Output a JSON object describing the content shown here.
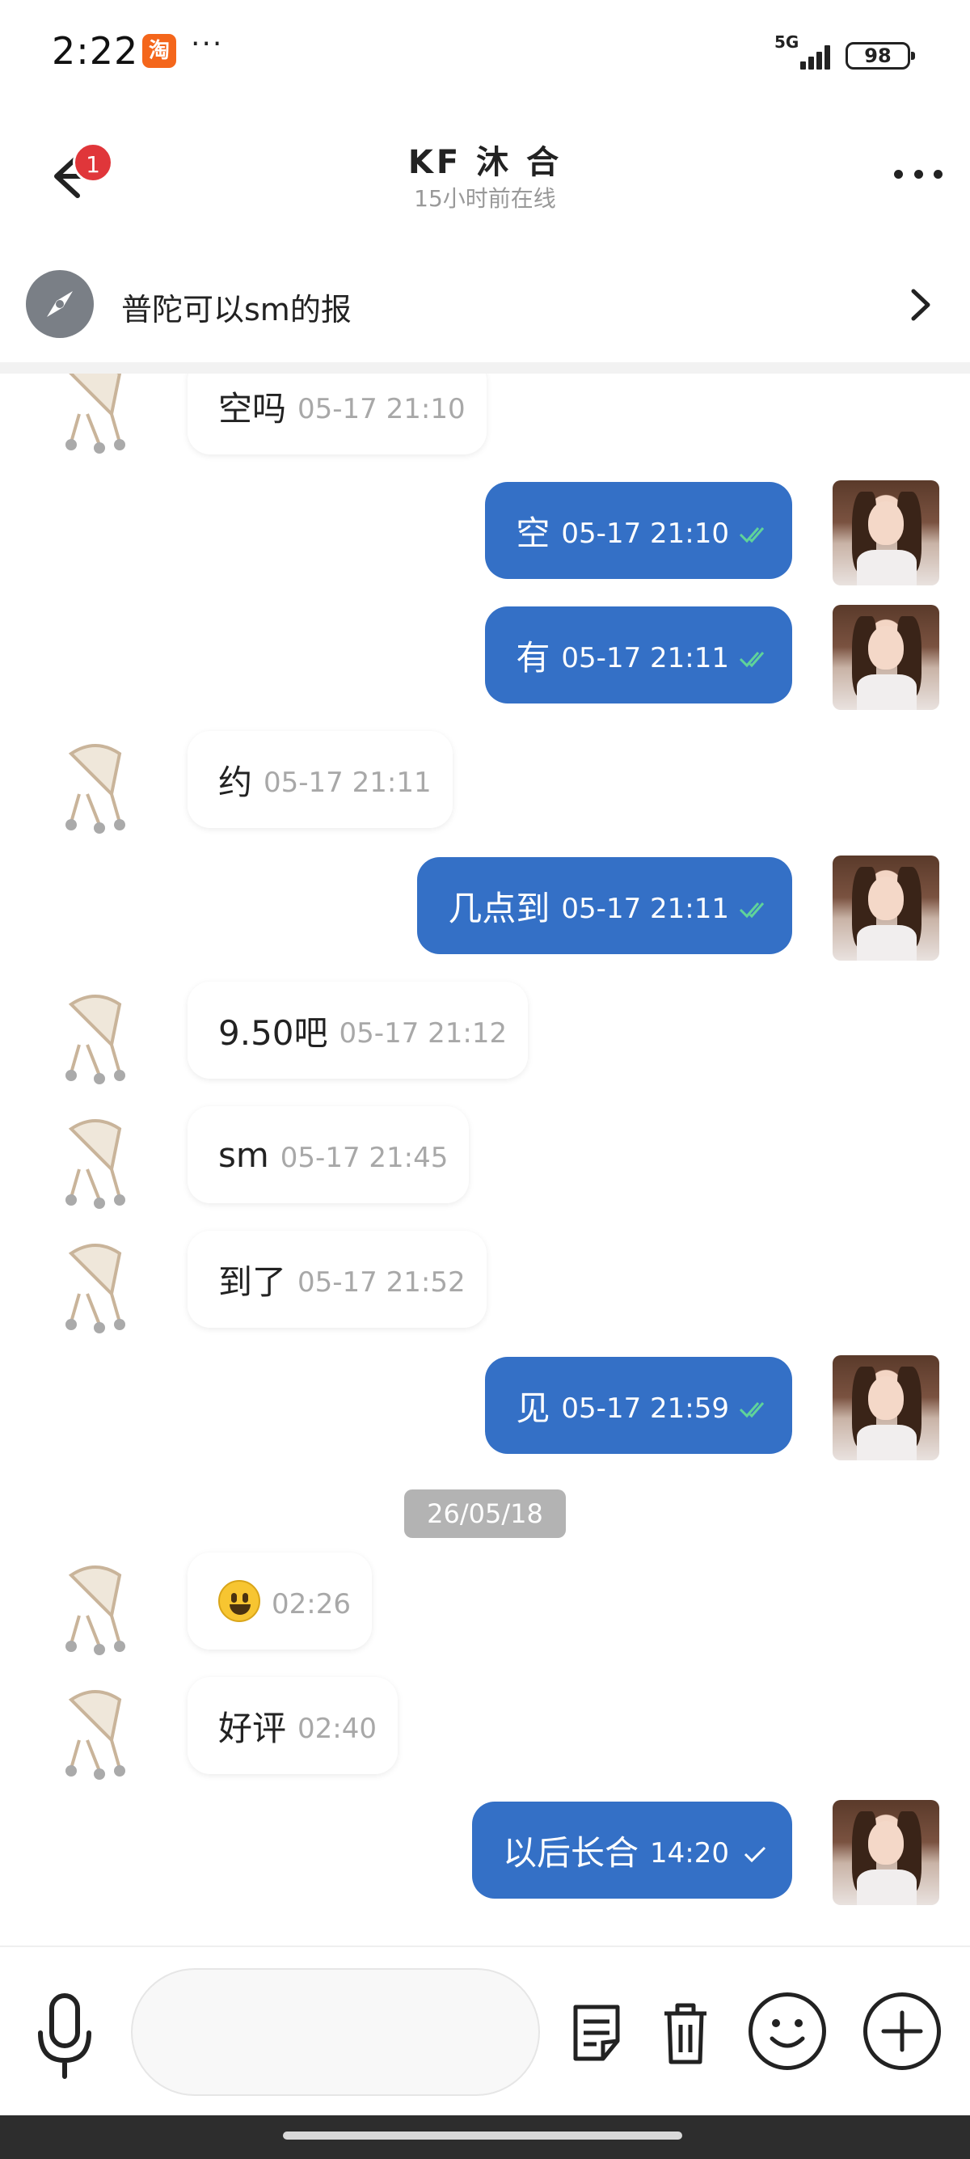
{
  "status_bar": {
    "time": "2:22",
    "app_icon_text": "淘",
    "more_dots": "···",
    "network": "5G",
    "battery": "98"
  },
  "header": {
    "back_badge": "1",
    "title": "KF 沐 合",
    "subtitle": "15小时前在线"
  },
  "pinned": {
    "text": "普陀可以sm的报"
  },
  "messages": [
    {
      "dir": "in",
      "text": "空吗",
      "time": "05-17 21:10"
    },
    {
      "dir": "out",
      "text": "空",
      "time": "05-17 21:10",
      "status": "read"
    },
    {
      "dir": "out",
      "text": "有",
      "time": "05-17 21:11",
      "status": "read"
    },
    {
      "dir": "in",
      "text": "约",
      "time": "05-17 21:11"
    },
    {
      "dir": "out",
      "text": "几点到",
      "time": "05-17 21:11",
      "status": "read"
    },
    {
      "dir": "in",
      "text": "9.50吧",
      "time": "05-17 21:12"
    },
    {
      "dir": "in",
      "text": "sm",
      "time": "05-17 21:45"
    },
    {
      "dir": "in",
      "text": "到了",
      "time": "05-17 21:52"
    },
    {
      "dir": "out",
      "text": "见",
      "time": "05-17 21:59",
      "status": "read"
    },
    {
      "dir": "in",
      "emoji": "smiley",
      "time": "02:26"
    },
    {
      "dir": "in",
      "text": "好评",
      "time": "02:40"
    },
    {
      "dir": "out",
      "text": "以后长合",
      "time": "14:20",
      "status": "sent"
    }
  ],
  "date_separator": "26/05/18",
  "input": {
    "value": "",
    "placeholder": ""
  },
  "colors": {
    "outgoing_bubble": "#3470c6",
    "read_check": "#5fd39a",
    "badge": "#e0363a"
  },
  "icons": {
    "back": "arrow-left-icon",
    "more": "more-horizontal-icon",
    "pinned": "compass-icon",
    "chevron": "chevron-right-icon",
    "mic": "microphone-icon",
    "note": "note-icon",
    "trash": "trash-icon",
    "emoji": "smiley-icon",
    "add": "plus-circle-icon"
  }
}
